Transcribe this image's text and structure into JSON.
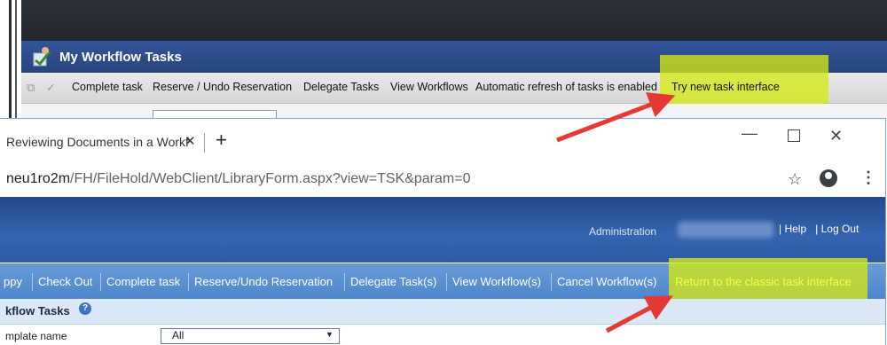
{
  "classic": {
    "title": "My Workflow Tasks",
    "toolbar_items": [
      "Complete task",
      "Reserve / Undo Reservation",
      "Delegate Tasks",
      "View Workflows",
      "Automatic refresh of tasks is enabled",
      "Try new task interface"
    ]
  },
  "browser": {
    "tab_title": "Reviewing Documents in a Workf",
    "url_host": "neu1ro2m",
    "url_path": "/FH/FileHold/WebClient/LibraryForm.aspx?view=TSK&param=0",
    "close_glyph": "✕",
    "newtab_glyph": "+"
  },
  "app": {
    "header_links": {
      "administration": "Administration",
      "help": "| Help",
      "logout": "| Log Out"
    },
    "commands": [
      "ppy",
      "Check Out",
      "Complete task",
      "Reserve/Undo Reservation",
      "Delegate Task(s)",
      "View Workflow(s)",
      "Cancel Workflow(s)",
      "Return to the classic task interface"
    ],
    "subhead_title": "kflow Tasks",
    "template_label": "mplate name",
    "template_value": "All"
  },
  "colors": {
    "highlight": "#d5e814",
    "arrow": "#e53935",
    "banner": "#2c5aa3",
    "command_bar": "#5a8fd2"
  }
}
